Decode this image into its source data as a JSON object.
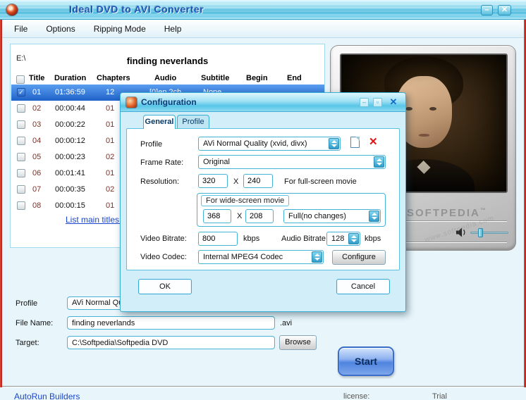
{
  "titlebar": {
    "title": "Ideal DVD to AVI Converter"
  },
  "glyphs": {
    "minimize": "–",
    "close": "✕",
    "check": "✓",
    "dialog_box": "▫"
  },
  "menu": {
    "items": [
      {
        "label": "File"
      },
      {
        "label": "Options"
      },
      {
        "label": "Ripping Mode"
      },
      {
        "label": "Help"
      }
    ]
  },
  "list": {
    "drive": "E:\\",
    "movie_title": "finding neverlands",
    "columns": {
      "title": "Title",
      "duration": "Duration",
      "chapters": "Chapters",
      "audio": "Audio",
      "subtitle": "Subtitle",
      "begin": "Begin",
      "end": "End"
    },
    "rows": [
      {
        "num": "01",
        "duration": "01:36:59",
        "chapters": "12",
        "audio": "[0]en 2ch",
        "subtitle": "None"
      },
      {
        "num": "02",
        "duration": "00:00:44",
        "chapters": "01"
      },
      {
        "num": "03",
        "duration": "00:00:22",
        "chapters": "01"
      },
      {
        "num": "04",
        "duration": "00:00:12",
        "chapters": "01"
      },
      {
        "num": "05",
        "duration": "00:00:23",
        "chapters": "02"
      },
      {
        "num": "06",
        "duration": "00:01:41",
        "chapters": "01"
      },
      {
        "num": "07",
        "duration": "00:00:35",
        "chapters": "02"
      },
      {
        "num": "08",
        "duration": "00:00:15",
        "chapters": "01"
      }
    ],
    "footer_link": "List main titles..."
  },
  "dialog": {
    "title": "Configuration",
    "tabs": [
      {
        "label": "General"
      },
      {
        "label": "Profile"
      }
    ],
    "profile_label": "Profile",
    "profile_value": "AVi Normal Quality (xvid, divx)",
    "framerate_label": "Frame Rate:",
    "framerate_value": "Original",
    "resolution_label": "Resolution:",
    "res_w": "320",
    "res_sep": "X",
    "res_h": "240",
    "fullscreen_note": "For full-screen movie",
    "widescreen_title": "For wide-screen movie",
    "ws_w": "368",
    "ws_sep": "X",
    "ws_h": "208",
    "ws_mode": "Full(no changes)",
    "vbitrate_label": "Video Bitrate:",
    "vbitrate_value": "800",
    "abitrate_label": "Audio Bitrate:",
    "abitrate_value": "128",
    "kbps": "kbps",
    "vcodec_label": "Video Codec:",
    "vcodec_value": "Internal MPEG4 Codec",
    "configure_button": "Configure",
    "ok_button": "OK",
    "cancel_button": "Cancel"
  },
  "form": {
    "profile_label": "Profile",
    "profile_value": "AVi Normal Quality (xvid, divx)",
    "filename_label": "File Name:",
    "filename_value": "finding neverlands",
    "filename_ext": ".avi",
    "target_label": "Target:",
    "target_value": "C:\\Softpedia\\Softpedia DVD",
    "browse_button": "Browse",
    "start_button": "Start"
  },
  "status": {
    "autorun_link": "AutoRun Builders",
    "license_label": "license:",
    "license_value": "Trial"
  },
  "watermark": {
    "brand": "SOFTPEDIA",
    "tm": "™",
    "url": "www.softpedia.com"
  }
}
